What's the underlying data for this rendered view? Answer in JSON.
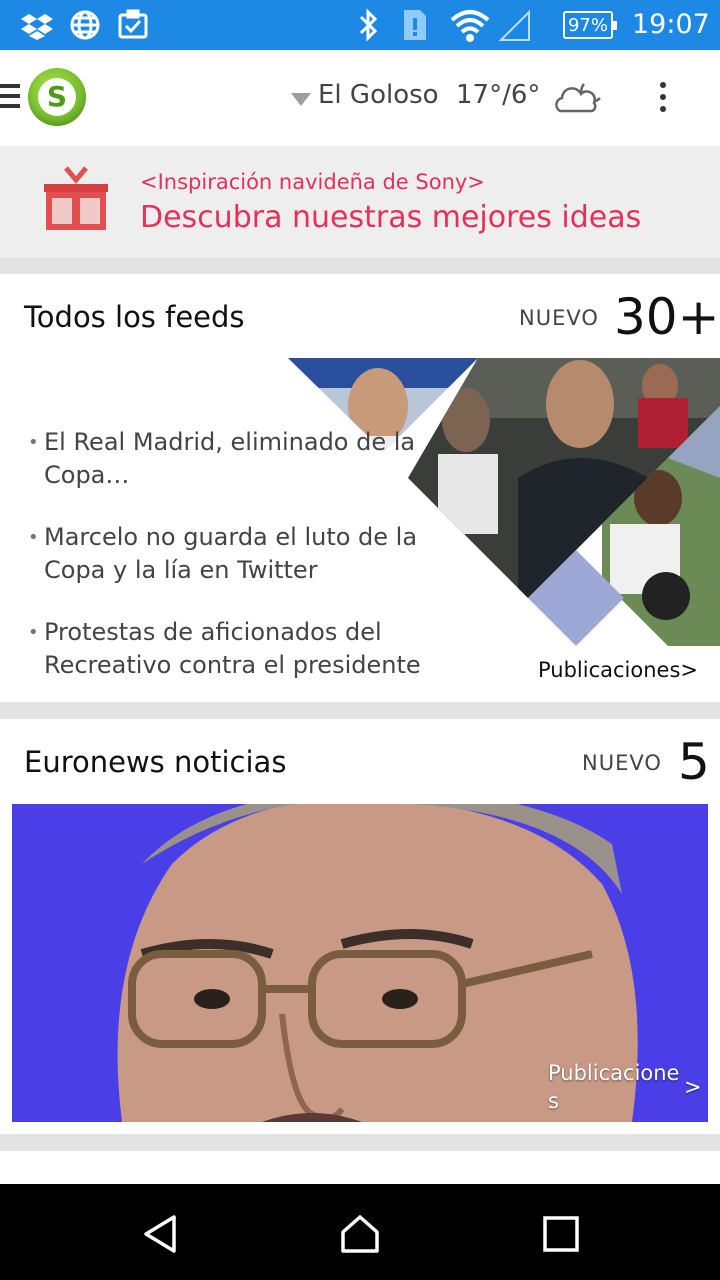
{
  "status_bar": {
    "battery": "97%",
    "time": "19:07",
    "icons": [
      "dropbox-icon",
      "globe-icon",
      "clipboard-icon",
      "bluetooth-icon",
      "alert-icon",
      "wifi-icon",
      "cell-signal-icon",
      "battery-icon"
    ]
  },
  "header": {
    "app_logo_letter": "S",
    "location": "El Goloso",
    "temperature": "17°/6°"
  },
  "promo": {
    "subtitle": "<Inspiración navideña de Sony>",
    "title": "Descubra nuestras mejores ideas"
  },
  "feeds": [
    {
      "title": "Todos los feeds",
      "new_label": "NUEVO",
      "count": "30+",
      "items": [
        "El Real Madrid, eliminado de la Copa…",
        "Marcelo no guarda el luto de la Copa y la lía en Twitter",
        "Protestas de aficionados del Recreativo contra el presidente"
      ],
      "link": "Publicaciones>"
    },
    {
      "title": "Euronews noticias",
      "new_label": "NUEVO",
      "count": "5",
      "link_line1": "Publicacione",
      "link_line2": "s",
      "link_arrow": ">"
    }
  ],
  "navbar": {
    "buttons": [
      "back-button",
      "home-button",
      "recents-button"
    ]
  },
  "colors": {
    "status_bar": "#1e88e5",
    "accent_promo": "#e5305a",
    "logo_green": "#58a81c"
  }
}
